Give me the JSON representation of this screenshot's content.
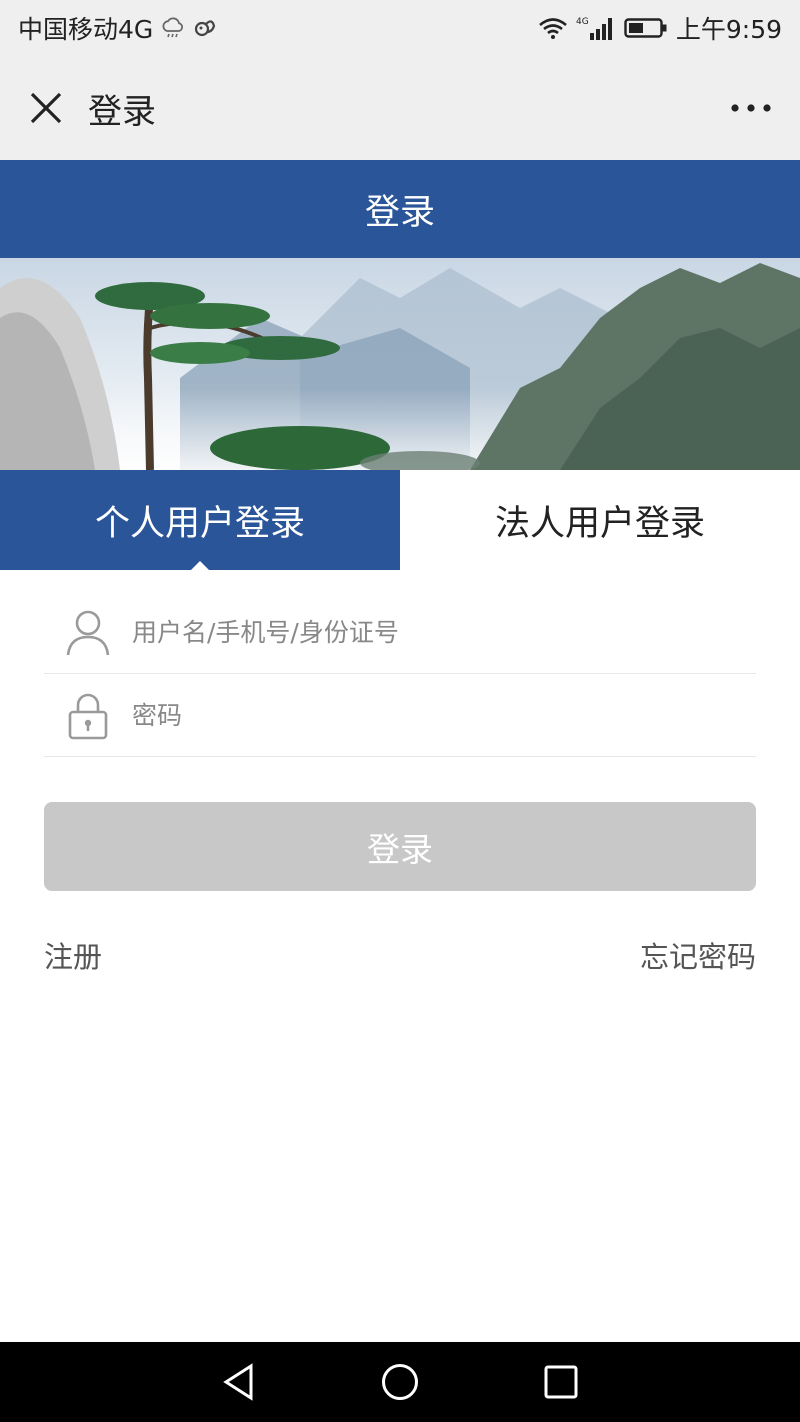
{
  "status_bar": {
    "carrier": "中国移动4G",
    "time": "上午9:59",
    "network": "4G"
  },
  "nav_bar": {
    "title": "登录"
  },
  "header": {
    "title": "登录"
  },
  "tabs": [
    {
      "label": "个人用户登录",
      "active": true
    },
    {
      "label": "法人用户登录",
      "active": false
    }
  ],
  "form": {
    "username_placeholder": "用户名/手机号/身份证号",
    "username_value": "",
    "password_placeholder": "密码",
    "password_value": "",
    "submit_label": "登录"
  },
  "links": {
    "register": "注册",
    "forgot_password": "忘记密码"
  },
  "colors": {
    "primary": "#2a5599",
    "button_disabled": "#c8c8c8",
    "bar_background": "#efefef"
  }
}
